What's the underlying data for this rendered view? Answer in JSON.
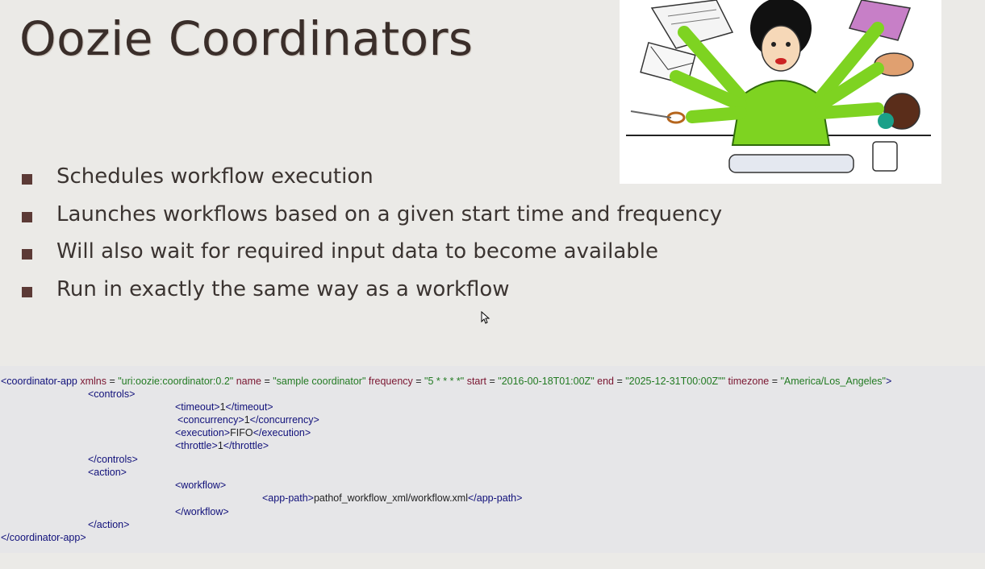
{
  "title": "Oozie Coordinators",
  "bullets": [
    "Schedules workflow execution",
    "Launches workflows based on a given start time and frequency",
    "Will also wait for required input data to become available",
    "Run in exactly the same way as a workflow"
  ],
  "code": {
    "root_open": "<coordinator-app",
    "attr_xmlns": " xmlns",
    "eq1": " = ",
    "val_xmlns": "\"uri:oozie:coordinator:0.2\"",
    "attr_name": " name",
    "eq2": " = ",
    "val_name": "\"sample coordinator\"",
    "attr_freq": " frequency",
    "eq3": " = ",
    "val_freq": "\"5 * * * *\"",
    "attr_start": " start",
    "eq4": " = ",
    "val_start": "\"2016-00-18T01:00Z\"",
    "attr_end": " end",
    "eq5": " = ",
    "val_end": "\"2025-12-31T00:00Z\"\"",
    "attr_tz": " timezone",
    "eq6": " = ",
    "val_tz": "\"America/Los_Angeles\"",
    "root_close_bracket": ">",
    "controls_open": "<controls>",
    "timeout_open": "<timeout>",
    "timeout_val": "1",
    "timeout_close": "</timeout>",
    "concurrency_open": "<concurrency>",
    "concurrency_val": "1",
    "concurrency_close": "</concurrency>",
    "execution_open": "<execution>",
    "execution_val": "FIFO",
    "execution_close": "</execution>",
    "throttle_open": "<throttle>",
    "throttle_val": "1",
    "throttle_close": "</throttle>",
    "controls_close": "</controls>",
    "action_open": "<action>",
    "workflow_open": "<workflow>",
    "apppath_open": "<app-path>",
    "apppath_val": "pathof_workflow_xml/workflow.xml",
    "apppath_close": "</app-path>",
    "workflow_close": "</workflow>",
    "action_close": "</action>",
    "root_close": "</coordinator-app>"
  },
  "colors": {
    "bullet": "#5c3a36",
    "tag": "#10107a",
    "attribute": "#7a1530",
    "value": "#227a22"
  },
  "illustration_icon": "multitasking-woman-clipart"
}
